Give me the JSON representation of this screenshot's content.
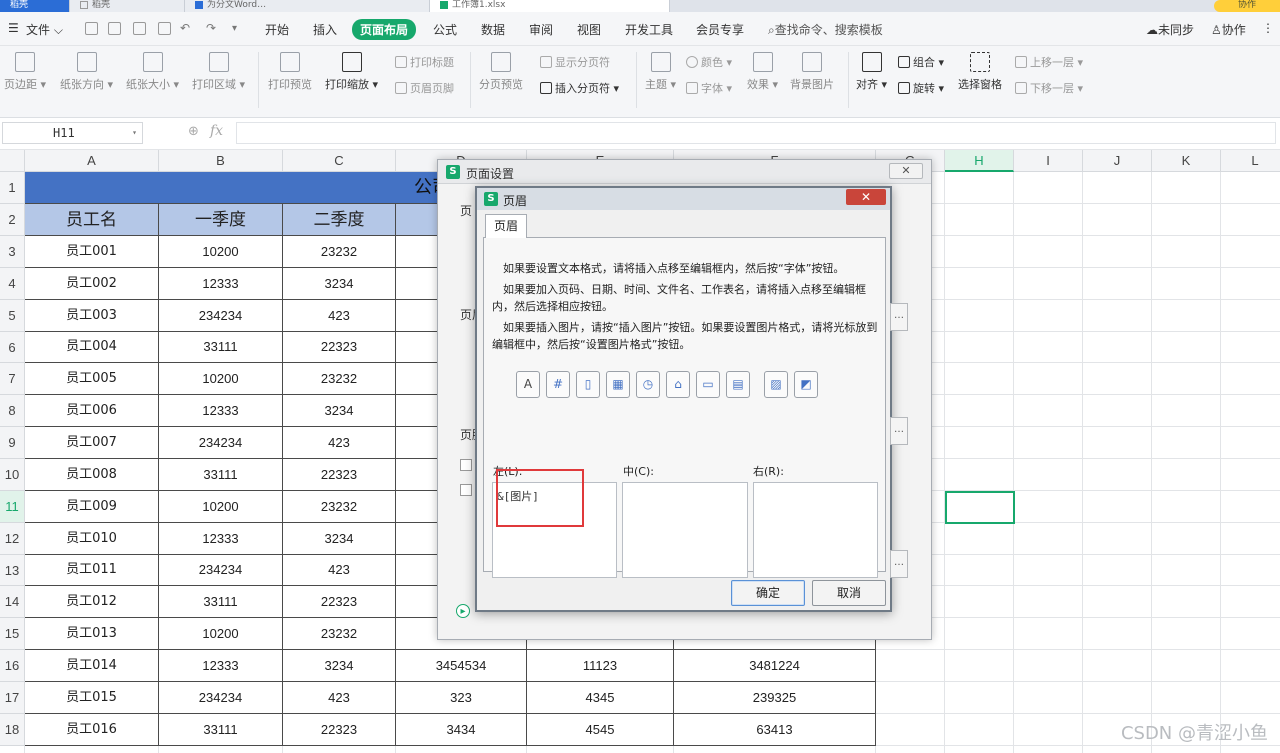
{
  "title_tabs": [
    {
      "label": "稻壳"
    },
    {
      "label": "稻壳"
    },
    {
      "label": "为分文Word…"
    },
    {
      "label": "工作簿1.xlsx"
    }
  ],
  "collab_label": "协作",
  "menu": {
    "file": "文件",
    "tabs": [
      "开始",
      "插入",
      "页面布局",
      "公式",
      "数据",
      "审阅",
      "视图",
      "开发工具",
      "会员专享"
    ],
    "active_tab": "页面布局",
    "search": "查找命令、搜索模板",
    "sync": "未同步",
    "collab": "协作"
  },
  "ribbon": {
    "margins": "页边距",
    "orientation": "纸张方向",
    "size": "纸张大小",
    "print_area": "打印区域",
    "print_preview": "打印预览",
    "print_scale": "打印缩放",
    "print_titles": "打印标题",
    "header_footer": "页眉页脚",
    "page_break_preview": "分页预览",
    "show_breaks": "显示分页符",
    "insert_break": "插入分页符",
    "theme": "主题",
    "colors": "颜色",
    "fonts": "字体",
    "effects": "效果",
    "background": "背景图片",
    "align": "对齐",
    "group": "组合",
    "rotate": "旋转",
    "selection_pane": "选择窗格",
    "bring_forward": "上移一层",
    "send_backward": "下移一层"
  },
  "formula_bar": {
    "name_box": "H11",
    "fx": "fx",
    "value": ""
  },
  "columns": [
    "A",
    "B",
    "C",
    "D",
    "E",
    "F",
    "G",
    "H",
    "I",
    "J",
    "K",
    "L"
  ],
  "selected_column": "H",
  "rows": [
    "1",
    "2",
    "3",
    "4",
    "5",
    "6",
    "7",
    "8",
    "9",
    "10",
    "11",
    "12",
    "13",
    "14",
    "15",
    "16",
    "17",
    "18"
  ],
  "selected_row": "11",
  "sheet_title": "公司员工",
  "table_header": [
    "员工名",
    "一季度",
    "二季度"
  ],
  "table_rows": [
    [
      "员工001",
      "10200",
      "23232",
      "",
      "",
      ""
    ],
    [
      "员工002",
      "12333",
      "3234",
      "",
      "",
      ""
    ],
    [
      "员工003",
      "234234",
      "423",
      "",
      "",
      ""
    ],
    [
      "员工004",
      "33111",
      "22323",
      "",
      "",
      ""
    ],
    [
      "员工005",
      "10200",
      "23232",
      "",
      "",
      ""
    ],
    [
      "员工006",
      "12333",
      "3234",
      "",
      "",
      ""
    ],
    [
      "员工007",
      "234234",
      "423",
      "",
      "",
      ""
    ],
    [
      "员工008",
      "33111",
      "22323",
      "",
      "",
      ""
    ],
    [
      "员工009",
      "10200",
      "23232",
      "",
      "",
      ""
    ],
    [
      "员工010",
      "12333",
      "3234",
      "",
      "",
      ""
    ],
    [
      "员工011",
      "234234",
      "423",
      "",
      "",
      ""
    ],
    [
      "员工012",
      "33111",
      "22323",
      "",
      "",
      ""
    ],
    [
      "员工013",
      "10200",
      "23232",
      "",
      "",
      ""
    ],
    [
      "员工014",
      "12333",
      "3234",
      "3454534",
      "11123",
      "3481224"
    ],
    [
      "员工015",
      "234234",
      "423",
      "323",
      "4345",
      "239325"
    ],
    [
      "员工016",
      "33111",
      "22323",
      "3434",
      "4545",
      "63413"
    ]
  ],
  "page_setup": {
    "title": "页面设置",
    "close": "✕",
    "side_labels": [
      "页",
      "页眉",
      "页脚"
    ]
  },
  "header_dialog": {
    "title": "页眉",
    "tab": "页眉",
    "para1": "如果要设置文本格式，请将插入点移至编辑框内，然后按“字体”按钮。",
    "para2": "如果要加入页码、日期、时间、文件名、工作表名，请将插入点移至编辑框内，然后选择相应按钮。",
    "para3": "如果要插入图片，请按“插入图片”按钮。如果要设置图片格式，请将光标放到编辑框中，然后按“设置图片格式”按钮。",
    "left_label": "左(L):",
    "center_label": "中(C):",
    "right_label": "右(R):",
    "left_value": "&[图片]",
    "center_value": "",
    "right_value": "",
    "ok": "确定",
    "cancel": "取消"
  },
  "watermark": "CSDN @青涩小鱼"
}
